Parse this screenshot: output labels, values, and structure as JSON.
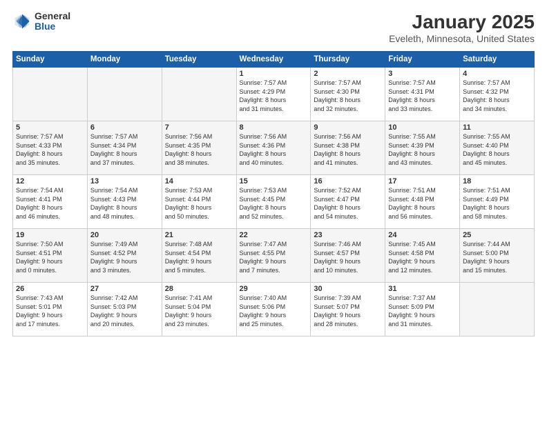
{
  "logo": {
    "general": "General",
    "blue": "Blue"
  },
  "header": {
    "title": "January 2025",
    "subtitle": "Eveleth, Minnesota, United States"
  },
  "weekdays": [
    "Sunday",
    "Monday",
    "Tuesday",
    "Wednesday",
    "Thursday",
    "Friday",
    "Saturday"
  ],
  "weeks": [
    [
      {
        "day": "",
        "info": ""
      },
      {
        "day": "",
        "info": ""
      },
      {
        "day": "",
        "info": ""
      },
      {
        "day": "1",
        "info": "Sunrise: 7:57 AM\nSunset: 4:29 PM\nDaylight: 8 hours\nand 31 minutes."
      },
      {
        "day": "2",
        "info": "Sunrise: 7:57 AM\nSunset: 4:30 PM\nDaylight: 8 hours\nand 32 minutes."
      },
      {
        "day": "3",
        "info": "Sunrise: 7:57 AM\nSunset: 4:31 PM\nDaylight: 8 hours\nand 33 minutes."
      },
      {
        "day": "4",
        "info": "Sunrise: 7:57 AM\nSunset: 4:32 PM\nDaylight: 8 hours\nand 34 minutes."
      }
    ],
    [
      {
        "day": "5",
        "info": "Sunrise: 7:57 AM\nSunset: 4:33 PM\nDaylight: 8 hours\nand 35 minutes."
      },
      {
        "day": "6",
        "info": "Sunrise: 7:57 AM\nSunset: 4:34 PM\nDaylight: 8 hours\nand 37 minutes."
      },
      {
        "day": "7",
        "info": "Sunrise: 7:56 AM\nSunset: 4:35 PM\nDaylight: 8 hours\nand 38 minutes."
      },
      {
        "day": "8",
        "info": "Sunrise: 7:56 AM\nSunset: 4:36 PM\nDaylight: 8 hours\nand 40 minutes."
      },
      {
        "day": "9",
        "info": "Sunrise: 7:56 AM\nSunset: 4:38 PM\nDaylight: 8 hours\nand 41 minutes."
      },
      {
        "day": "10",
        "info": "Sunrise: 7:55 AM\nSunset: 4:39 PM\nDaylight: 8 hours\nand 43 minutes."
      },
      {
        "day": "11",
        "info": "Sunrise: 7:55 AM\nSunset: 4:40 PM\nDaylight: 8 hours\nand 45 minutes."
      }
    ],
    [
      {
        "day": "12",
        "info": "Sunrise: 7:54 AM\nSunset: 4:41 PM\nDaylight: 8 hours\nand 46 minutes."
      },
      {
        "day": "13",
        "info": "Sunrise: 7:54 AM\nSunset: 4:43 PM\nDaylight: 8 hours\nand 48 minutes."
      },
      {
        "day": "14",
        "info": "Sunrise: 7:53 AM\nSunset: 4:44 PM\nDaylight: 8 hours\nand 50 minutes."
      },
      {
        "day": "15",
        "info": "Sunrise: 7:53 AM\nSunset: 4:45 PM\nDaylight: 8 hours\nand 52 minutes."
      },
      {
        "day": "16",
        "info": "Sunrise: 7:52 AM\nSunset: 4:47 PM\nDaylight: 8 hours\nand 54 minutes."
      },
      {
        "day": "17",
        "info": "Sunrise: 7:51 AM\nSunset: 4:48 PM\nDaylight: 8 hours\nand 56 minutes."
      },
      {
        "day": "18",
        "info": "Sunrise: 7:51 AM\nSunset: 4:49 PM\nDaylight: 8 hours\nand 58 minutes."
      }
    ],
    [
      {
        "day": "19",
        "info": "Sunrise: 7:50 AM\nSunset: 4:51 PM\nDaylight: 9 hours\nand 0 minutes."
      },
      {
        "day": "20",
        "info": "Sunrise: 7:49 AM\nSunset: 4:52 PM\nDaylight: 9 hours\nand 3 minutes."
      },
      {
        "day": "21",
        "info": "Sunrise: 7:48 AM\nSunset: 4:54 PM\nDaylight: 9 hours\nand 5 minutes."
      },
      {
        "day": "22",
        "info": "Sunrise: 7:47 AM\nSunset: 4:55 PM\nDaylight: 9 hours\nand 7 minutes."
      },
      {
        "day": "23",
        "info": "Sunrise: 7:46 AM\nSunset: 4:57 PM\nDaylight: 9 hours\nand 10 minutes."
      },
      {
        "day": "24",
        "info": "Sunrise: 7:45 AM\nSunset: 4:58 PM\nDaylight: 9 hours\nand 12 minutes."
      },
      {
        "day": "25",
        "info": "Sunrise: 7:44 AM\nSunset: 5:00 PM\nDaylight: 9 hours\nand 15 minutes."
      }
    ],
    [
      {
        "day": "26",
        "info": "Sunrise: 7:43 AM\nSunset: 5:01 PM\nDaylight: 9 hours\nand 17 minutes."
      },
      {
        "day": "27",
        "info": "Sunrise: 7:42 AM\nSunset: 5:03 PM\nDaylight: 9 hours\nand 20 minutes."
      },
      {
        "day": "28",
        "info": "Sunrise: 7:41 AM\nSunset: 5:04 PM\nDaylight: 9 hours\nand 23 minutes."
      },
      {
        "day": "29",
        "info": "Sunrise: 7:40 AM\nSunset: 5:06 PM\nDaylight: 9 hours\nand 25 minutes."
      },
      {
        "day": "30",
        "info": "Sunrise: 7:39 AM\nSunset: 5:07 PM\nDaylight: 9 hours\nand 28 minutes."
      },
      {
        "day": "31",
        "info": "Sunrise: 7:37 AM\nSunset: 5:09 PM\nDaylight: 9 hours\nand 31 minutes."
      },
      {
        "day": "",
        "info": ""
      }
    ]
  ]
}
